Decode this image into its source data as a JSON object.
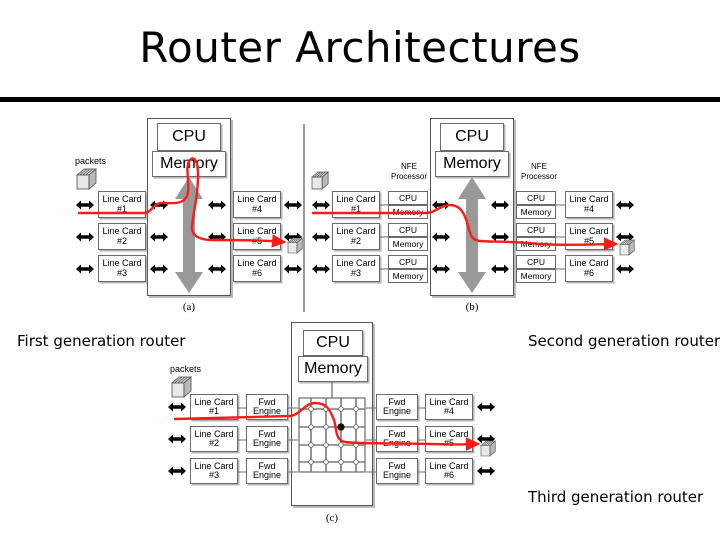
{
  "slide": {
    "title": "Router Architectures",
    "background_color": "#ffffff",
    "rule_color": "#000000"
  },
  "colors": {
    "path_red": "#ff1a1a",
    "bus_gray": "#999999",
    "box_border": "#6b6b6b",
    "divider_gray": "#9a9a9a",
    "text": "#000000"
  },
  "figures": [
    {
      "id": "a",
      "figure_label": "(a)",
      "caption": "First generation router",
      "packets_label": "packets",
      "cpu_label": "CPU",
      "memory_label": "Memory",
      "left_line_cards": [
        {
          "line1": "Line Card",
          "line2": "#1"
        },
        {
          "line1": "Line Card",
          "line2": "#2"
        },
        {
          "line1": "Line Card",
          "line2": "#3"
        }
      ],
      "right_line_cards": [
        {
          "line1": "Line Card",
          "line2": "#4"
        },
        {
          "line1": "Line Card",
          "line2": "#5"
        },
        {
          "line1": "Line Card",
          "line2": "#6"
        }
      ]
    },
    {
      "id": "b",
      "figure_label": "(b)",
      "caption": "Second generation router",
      "cpu_label": "CPU",
      "memory_label": "Memory",
      "nfe_label": "NFE\nProcessor",
      "nfe_cpu_label": "CPU",
      "nfe_memory_label": "Memory",
      "left_line_cards": [
        {
          "line1": "Line Card",
          "line2": "#1"
        },
        {
          "line1": "Line Card",
          "line2": "#2"
        },
        {
          "line1": "Line Card",
          "line2": "#3"
        }
      ],
      "right_line_cards": [
        {
          "line1": "Line Card",
          "line2": "#4"
        },
        {
          "line1": "Line Card",
          "line2": "#5"
        },
        {
          "line1": "Line Card",
          "line2": "#6"
        }
      ]
    },
    {
      "id": "c",
      "figure_label": "(c)",
      "caption": "Third generation router",
      "packets_label": "packets",
      "cpu_label": "CPU",
      "memory_label": "Memory",
      "fwd_engine": {
        "line1": "Fwd",
        "line2": "Engine"
      },
      "left_line_cards": [
        {
          "line1": "Line Card",
          "line2": "#1"
        },
        {
          "line1": "Line Card",
          "line2": "#2"
        },
        {
          "line1": "Line Card",
          "line2": "#3"
        }
      ],
      "right_line_cards": [
        {
          "line1": "Line Card",
          "line2": "#4"
        },
        {
          "line1": "Line Card",
          "line2": "#5"
        },
        {
          "line1": "Line Card",
          "line2": "#6"
        }
      ],
      "crossbar": {
        "rows": 4,
        "columns": 4,
        "active_node_row": 2,
        "active_node_column": 3
      }
    }
  ],
  "icons": {
    "packet_stack": "packet-stack-icon",
    "bus_arrow": "double-headed-arrow-icon",
    "flow_arrow": "red-packet-flow-arrow"
  }
}
